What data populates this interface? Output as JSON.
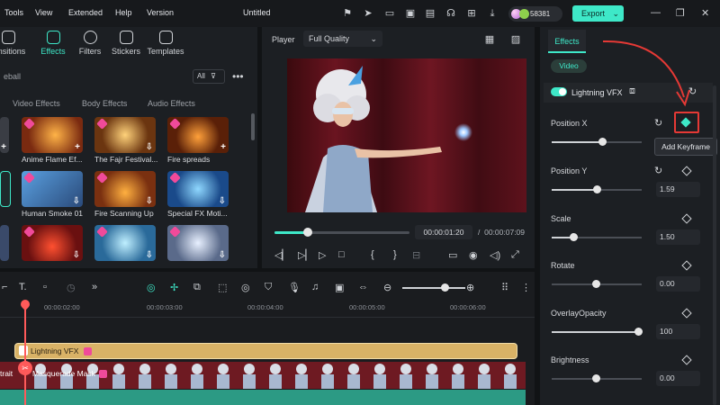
{
  "topbar": {
    "menu": [
      "Tools",
      "View",
      "Extended",
      "Help",
      "Version"
    ],
    "title": "Untitled",
    "credits": "58381",
    "export_label": "Export",
    "export_arrow": "⌄"
  },
  "library": {
    "tabs": [
      {
        "label": "ransitions",
        "icon": "transitions-icon"
      },
      {
        "label": "Effects",
        "icon": "effects-icon"
      },
      {
        "label": "Filters",
        "icon": "filters-icon"
      },
      {
        "label": "Stickers",
        "icon": "stickers-icon"
      },
      {
        "label": "Templates",
        "icon": "templates-icon"
      }
    ],
    "search_text": "eball",
    "filter_label": "All",
    "subtabs": [
      "Video Effects",
      "Body Effects",
      "Audio Effects"
    ],
    "items": [
      {
        "label": "Anime Flame Ef...",
        "color": "#7a2a10"
      },
      {
        "label": "The Fajr Festival...",
        "color": "#6b3510"
      },
      {
        "label": "Fire spreads",
        "color": "#5a2008"
      },
      {
        "label": "Human Smoke 01",
        "color": "#2a4a7a"
      },
      {
        "label": "Fire Scanning Up",
        "color": "#7a3010"
      },
      {
        "label": "Special FX Moti...",
        "color": "#1a4a8a"
      },
      {
        "label": "",
        "color": "#6a1010"
      },
      {
        "label": "",
        "color": "#2a6a9a"
      },
      {
        "label": "",
        "color": "#5a6a8a"
      }
    ]
  },
  "player": {
    "label": "Player",
    "quality": "Full Quality",
    "current_time": "00:00:01:20",
    "separator": "/",
    "total_time": "00:00:07:09",
    "progress": 0.24
  },
  "timeline": {
    "ruler": [
      "00:00:02:00",
      "00:00:03:00",
      "00:00:04:00",
      "00:00:05:00",
      "00:00:06:00"
    ],
    "fx_clip": "Lightning VFX",
    "video_clip": "Masquerade Mask",
    "video_clip_prefix": "trait"
  },
  "properties": {
    "tab": "Effects",
    "chip": "Video",
    "effect_name": "Lightning VFX",
    "params": [
      {
        "label": "Position X",
        "value": ""
      },
      {
        "label": "Position Y",
        "value": "1.59"
      },
      {
        "label": "Scale",
        "value": "1.50"
      },
      {
        "label": "Rotate",
        "value": "0.00"
      },
      {
        "label": "OverlayOpacity",
        "value": "100"
      },
      {
        "label": "Brightness",
        "value": "0.00"
      }
    ],
    "tooltip": "Add Keyframe"
  },
  "colors": {
    "accent": "#3ee8c8",
    "highlight": "#e53935"
  }
}
